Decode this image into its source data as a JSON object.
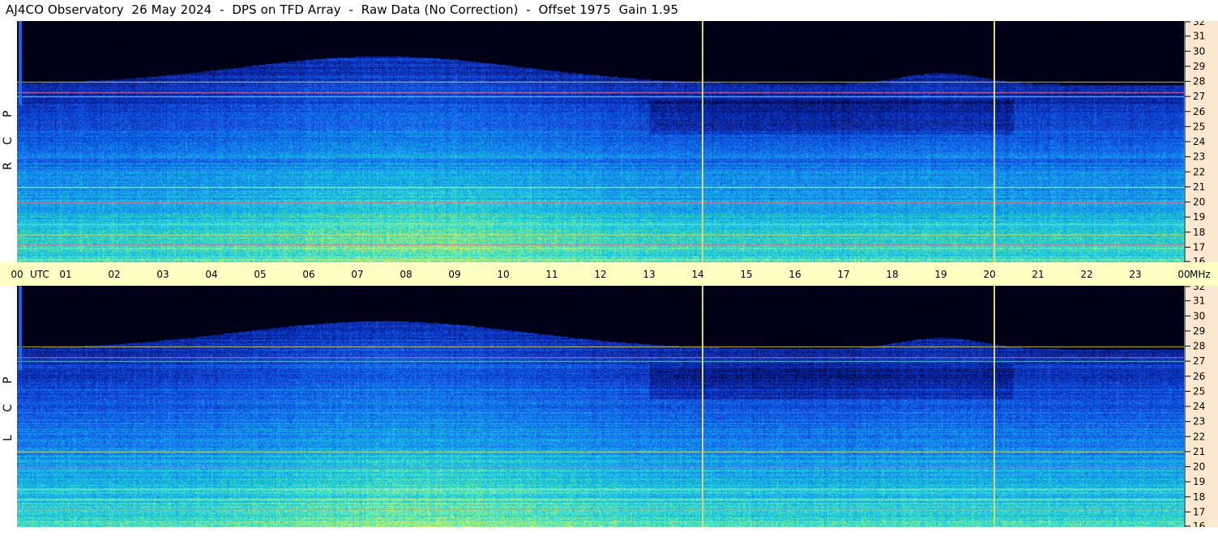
{
  "title": "AJ4CO Observatory  26 May 2024  -  DPS on TFD Array  -  Raw Data (No Correction)  -  Offset 1975  Gain 1.95",
  "colors": {
    "time_axis_bg": "#ffffc4",
    "freq_axis_bg": "#fce7d0",
    "marker_line": "#d8d870"
  },
  "chart_data": {
    "type": "heatmap",
    "x_unit": "UTC",
    "y_unit": "MHz",
    "x_ticks": [
      "00",
      "01",
      "02",
      "03",
      "04",
      "05",
      "06",
      "07",
      "08",
      "09",
      "10",
      "11",
      "12",
      "13",
      "14",
      "15",
      "16",
      "17",
      "18",
      "19",
      "20",
      "21",
      "22",
      "23",
      "00"
    ],
    "y_ticks": [
      16,
      17,
      18,
      19,
      20,
      21,
      22,
      23,
      24,
      25,
      26,
      27,
      28,
      29,
      30,
      31,
      32
    ],
    "xlim": [
      0,
      24
    ],
    "ylim": [
      16,
      32
    ],
    "time_marker_utc": [
      14.1,
      20.1
    ],
    "panels": [
      {
        "name": "R C P",
        "side_letters": [
          "R",
          "C",
          "P"
        ],
        "persistent_lines_mhz": [
          17.2,
          17.8,
          18.5,
          20.0,
          21.0,
          27.0,
          27.3,
          28.0
        ]
      },
      {
        "name": "L C P",
        "side_letters": [
          "L",
          "C",
          "P"
        ],
        "persistent_lines_mhz": [
          17.2,
          17.8,
          18.5,
          20.0,
          21.0,
          27.0,
          27.3,
          28.0
        ]
      }
    ]
  }
}
